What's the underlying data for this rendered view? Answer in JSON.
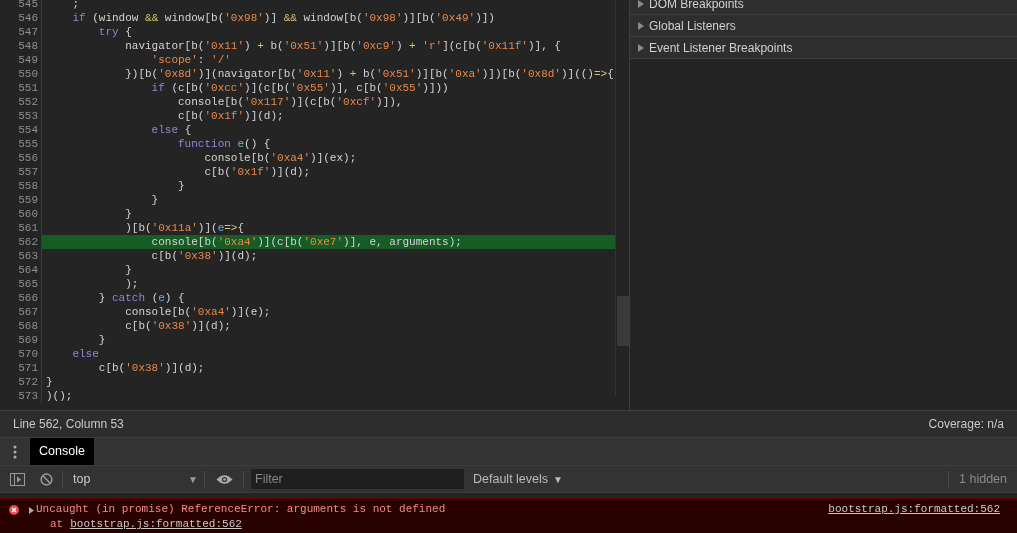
{
  "editor": {
    "lines": [
      {
        "number": "545",
        "highlighted": false,
        "tokens": [
          {
            "text": "    ;",
            "kind": "plain"
          }
        ]
      },
      {
        "number": "546",
        "highlighted": false,
        "tokens": [
          {
            "text": "    if",
            "kind": "keyword"
          },
          {
            "text": " (window ",
            "kind": "plain"
          },
          {
            "text": "&&",
            "kind": "operator"
          },
          {
            "text": " window[b(",
            "kind": "plain"
          },
          {
            "text": "'0x98'",
            "kind": "string"
          },
          {
            "text": ")] ",
            "kind": "plain"
          },
          {
            "text": "&&",
            "kind": "operator"
          },
          {
            "text": " window[b(",
            "kind": "plain"
          },
          {
            "text": "'0x98'",
            "kind": "string"
          },
          {
            "text": ")][b(",
            "kind": "plain"
          },
          {
            "text": "'0x49'",
            "kind": "string"
          },
          {
            "text": ")])",
            "kind": "plain"
          }
        ]
      },
      {
        "number": "547",
        "highlighted": false,
        "tokens": [
          {
            "text": "        try",
            "kind": "keyword"
          },
          {
            "text": " {",
            "kind": "plain"
          }
        ]
      },
      {
        "number": "548",
        "highlighted": false,
        "tokens": [
          {
            "text": "            navigator[b(",
            "kind": "plain"
          },
          {
            "text": "'0x11'",
            "kind": "string"
          },
          {
            "text": ") ",
            "kind": "plain"
          },
          {
            "text": "+",
            "kind": "operator"
          },
          {
            "text": " b(",
            "kind": "plain"
          },
          {
            "text": "'0x51'",
            "kind": "string"
          },
          {
            "text": ")][b(",
            "kind": "plain"
          },
          {
            "text": "'0xc9'",
            "kind": "string"
          },
          {
            "text": ") ",
            "kind": "plain"
          },
          {
            "text": "+",
            "kind": "operator"
          },
          {
            "text": " 'r'",
            "kind": "string"
          },
          {
            "text": "](c[b(",
            "kind": "plain"
          },
          {
            "text": "'0x11f'",
            "kind": "string"
          },
          {
            "text": ")], {",
            "kind": "plain"
          }
        ]
      },
      {
        "number": "549",
        "highlighted": false,
        "tokens": [
          {
            "text": "                'scope'",
            "kind": "string"
          },
          {
            "text": ": ",
            "kind": "plain"
          },
          {
            "text": "'/'",
            "kind": "string"
          }
        ]
      },
      {
        "number": "550",
        "highlighted": false,
        "tokens": [
          {
            "text": "            })[b(",
            "kind": "plain"
          },
          {
            "text": "'0x8d'",
            "kind": "string"
          },
          {
            "text": ")](navigator[b(",
            "kind": "plain"
          },
          {
            "text": "'0x11'",
            "kind": "string"
          },
          {
            "text": ") ",
            "kind": "plain"
          },
          {
            "text": "+",
            "kind": "operator"
          },
          {
            "text": " b(",
            "kind": "plain"
          },
          {
            "text": "'0x51'",
            "kind": "string"
          },
          {
            "text": ")][b(",
            "kind": "plain"
          },
          {
            "text": "'0xa'",
            "kind": "string"
          },
          {
            "text": ")])[b(",
            "kind": "plain"
          },
          {
            "text": "'0x8d'",
            "kind": "string"
          },
          {
            "text": ")](()",
            "kind": "plain"
          },
          {
            "text": "=>",
            "kind": "operator"
          },
          {
            "text": "{",
            "kind": "plain"
          }
        ]
      },
      {
        "number": "551",
        "highlighted": false,
        "tokens": [
          {
            "text": "                if",
            "kind": "keyword"
          },
          {
            "text": " (c[b(",
            "kind": "plain"
          },
          {
            "text": "'0xcc'",
            "kind": "string"
          },
          {
            "text": ")](c[b(",
            "kind": "plain"
          },
          {
            "text": "'0x55'",
            "kind": "string"
          },
          {
            "text": ")], c[b(",
            "kind": "plain"
          },
          {
            "text": "'0x55'",
            "kind": "string"
          },
          {
            "text": ")]))",
            "kind": "plain"
          }
        ]
      },
      {
        "number": "552",
        "highlighted": false,
        "tokens": [
          {
            "text": "                    console[b(",
            "kind": "plain"
          },
          {
            "text": "'0x117'",
            "kind": "string"
          },
          {
            "text": ")](c[b(",
            "kind": "plain"
          },
          {
            "text": "'0xcf'",
            "kind": "string"
          },
          {
            "text": ")]),",
            "kind": "plain"
          }
        ]
      },
      {
        "number": "553",
        "highlighted": false,
        "tokens": [
          {
            "text": "                    c[b(",
            "kind": "plain"
          },
          {
            "text": "'0x1f'",
            "kind": "string"
          },
          {
            "text": ")](d);",
            "kind": "plain"
          }
        ]
      },
      {
        "number": "554",
        "highlighted": false,
        "tokens": [
          {
            "text": "                else",
            "kind": "keyword"
          },
          {
            "text": " {",
            "kind": "plain"
          }
        ]
      },
      {
        "number": "555",
        "highlighted": false,
        "tokens": [
          {
            "text": "                    function ",
            "kind": "keyword"
          },
          {
            "text": "e",
            "kind": "param"
          },
          {
            "text": "() {",
            "kind": "plain"
          }
        ]
      },
      {
        "number": "556",
        "highlighted": false,
        "tokens": [
          {
            "text": "                        console[b(",
            "kind": "plain"
          },
          {
            "text": "'0xa4'",
            "kind": "string"
          },
          {
            "text": ")](ex);",
            "kind": "plain"
          }
        ]
      },
      {
        "number": "557",
        "highlighted": false,
        "tokens": [
          {
            "text": "                        c[b(",
            "kind": "plain"
          },
          {
            "text": "'0x1f'",
            "kind": "string"
          },
          {
            "text": ")](d);",
            "kind": "plain"
          }
        ]
      },
      {
        "number": "558",
        "highlighted": false,
        "tokens": [
          {
            "text": "                    }",
            "kind": "plain"
          }
        ]
      },
      {
        "number": "559",
        "highlighted": false,
        "tokens": [
          {
            "text": "                }",
            "kind": "plain"
          }
        ]
      },
      {
        "number": "560",
        "highlighted": false,
        "tokens": [
          {
            "text": "            }",
            "kind": "plain"
          }
        ]
      },
      {
        "number": "561",
        "highlighted": false,
        "tokens": [
          {
            "text": "            )[b(",
            "kind": "plain"
          },
          {
            "text": "'0x11a'",
            "kind": "string"
          },
          {
            "text": ")](",
            "kind": "plain"
          },
          {
            "text": "e",
            "kind": "param"
          },
          {
            "text": "=>",
            "kind": "operator"
          },
          {
            "text": "{",
            "kind": "plain"
          }
        ]
      },
      {
        "number": "562",
        "highlighted": true,
        "tokens": [
          {
            "text": "                console[b(",
            "kind": "plain"
          },
          {
            "text": "'0xa4'",
            "kind": "string"
          },
          {
            "text": ")](c[b(",
            "kind": "plain"
          },
          {
            "text": "'0xe7'",
            "kind": "string"
          },
          {
            "text": ")], e, arguments);",
            "kind": "plain"
          }
        ]
      },
      {
        "number": "563",
        "highlighted": false,
        "tokens": [
          {
            "text": "                c[b(",
            "kind": "plain"
          },
          {
            "text": "'0x38'",
            "kind": "string"
          },
          {
            "text": ")](d);",
            "kind": "plain"
          }
        ]
      },
      {
        "number": "564",
        "highlighted": false,
        "tokens": [
          {
            "text": "            }",
            "kind": "plain"
          }
        ]
      },
      {
        "number": "565",
        "highlighted": false,
        "tokens": [
          {
            "text": "            );",
            "kind": "plain"
          }
        ]
      },
      {
        "number": "566",
        "highlighted": false,
        "tokens": [
          {
            "text": "        } ",
            "kind": "plain"
          },
          {
            "text": "catch",
            "kind": "keyword"
          },
          {
            "text": " (",
            "kind": "plain"
          },
          {
            "text": "e",
            "kind": "param"
          },
          {
            "text": ") {",
            "kind": "plain"
          }
        ]
      },
      {
        "number": "567",
        "highlighted": false,
        "tokens": [
          {
            "text": "            console[b(",
            "kind": "plain"
          },
          {
            "text": "'0xa4'",
            "kind": "string"
          },
          {
            "text": ")](e);",
            "kind": "plain"
          }
        ]
      },
      {
        "number": "568",
        "highlighted": false,
        "tokens": [
          {
            "text": "            c[b(",
            "kind": "plain"
          },
          {
            "text": "'0x38'",
            "kind": "string"
          },
          {
            "text": ")](d);",
            "kind": "plain"
          }
        ]
      },
      {
        "number": "569",
        "highlighted": false,
        "tokens": [
          {
            "text": "        }",
            "kind": "plain"
          }
        ]
      },
      {
        "number": "570",
        "highlighted": false,
        "tokens": [
          {
            "text": "    else",
            "kind": "keyword"
          }
        ]
      },
      {
        "number": "571",
        "highlighted": false,
        "tokens": [
          {
            "text": "        c[b(",
            "kind": "plain"
          },
          {
            "text": "'0x38'",
            "kind": "string"
          },
          {
            "text": ")](d);",
            "kind": "plain"
          }
        ]
      },
      {
        "number": "572",
        "highlighted": false,
        "tokens": [
          {
            "text": "}",
            "kind": "plain"
          }
        ]
      },
      {
        "number": "573",
        "highlighted": false,
        "tokens": [
          {
            "text": ")();",
            "kind": "plain"
          }
        ]
      }
    ]
  },
  "status_bar": {
    "position": "Line 562, Column 53",
    "coverage": "Coverage: n/a"
  },
  "sidebar": {
    "sections": [
      {
        "label": "DOM Breakpoints",
        "expanded": false
      },
      {
        "label": "Global Listeners",
        "expanded": false
      },
      {
        "label": "Event Listener Breakpoints",
        "expanded": false
      }
    ]
  },
  "drawer": {
    "tabs": [
      {
        "label": "Console",
        "selected": true
      }
    ]
  },
  "console_toolbar": {
    "context": "top",
    "filter": {
      "placeholder": "Filter"
    },
    "levels": "Default levels",
    "levels_caret": "▼",
    "context_caret": "▼",
    "hidden": "1 hidden"
  },
  "messages": [
    {
      "kind": "error",
      "text": "Uncaught (in promise) ReferenceError: arguments is not defined",
      "at": "at",
      "stack_link": "bootstrap.js:formatted:562",
      "source": "bootstrap.js:formatted:562"
    }
  ]
}
